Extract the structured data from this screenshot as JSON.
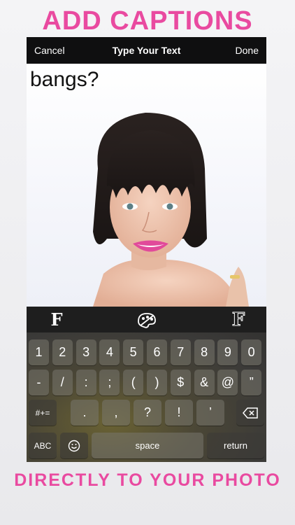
{
  "promo": {
    "top": "ADD CAPTIONS",
    "bottom": "DIRECTLY TO YOUR PHOTO"
  },
  "navbar": {
    "cancel": "Cancel",
    "title": "Type Your Text",
    "done": "Done"
  },
  "canvas": {
    "caption": "bangs?"
  },
  "toolbar": {
    "font_serif": "F",
    "color_icon": "palette-icon",
    "font_outline": "F"
  },
  "keyboard": {
    "row1": [
      "1",
      "2",
      "3",
      "4",
      "5",
      "6",
      "7",
      "8",
      "9",
      "0"
    ],
    "row2": [
      "-",
      "/",
      ":",
      ";",
      "(",
      ")",
      "$",
      "&",
      "@",
      "”"
    ],
    "row3_left": "#+=",
    "row3": [
      ".",
      ",",
      "?",
      "!",
      "’"
    ],
    "row3_right_icon": "backspace-icon",
    "row4": {
      "abc": "ABC",
      "emoji_icon": "emoji-icon",
      "space": "space",
      "return": "return"
    }
  },
  "colors": {
    "accent_pink": "#e94aa0",
    "navbar": "#0f0f10"
  }
}
